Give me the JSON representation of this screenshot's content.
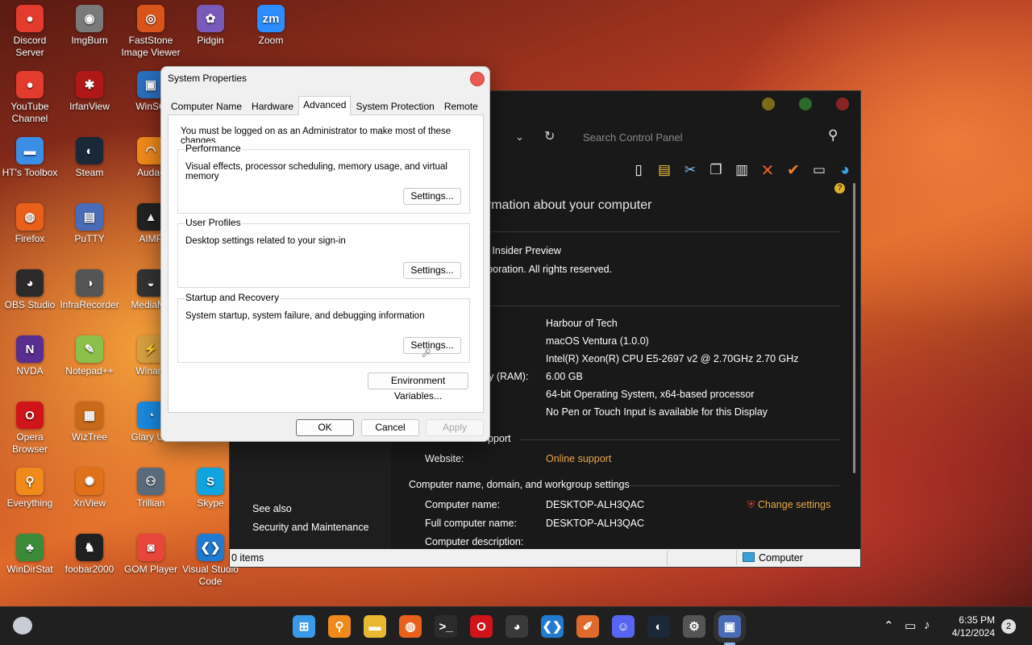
{
  "desktop": {
    "icons": [
      {
        "label": "Discord Server",
        "glyph": "●",
        "color": "#e33b2e"
      },
      {
        "label": "ImgBurn",
        "glyph": "◉",
        "color": "#7a7a7a"
      },
      {
        "label": "FastStone Image Viewer",
        "glyph": "◎",
        "color": "#d8541a"
      },
      {
        "label": "Pidgin",
        "glyph": "✿",
        "color": "#7a5ab8"
      },
      {
        "label": "Zoom",
        "glyph": "zm",
        "color": "#2d8cff"
      },
      {
        "label": "YouTube Channel",
        "glyph": "●",
        "color": "#e33b2e"
      },
      {
        "label": "IrfanView",
        "glyph": "✱",
        "color": "#b01818"
      },
      {
        "label": "WinSC",
        "glyph": "▣",
        "color": "#2a6fbf"
      },
      {
        "label": "HT's Toolbox",
        "glyph": "▬",
        "color": "#3a8ee6"
      },
      {
        "label": "Steam",
        "glyph": "◐",
        "color": "#1b2838"
      },
      {
        "label": "Audac",
        "glyph": "◠",
        "color": "#f08a1a"
      },
      {
        "label": "Firefox",
        "glyph": "◍",
        "color": "#e8601a"
      },
      {
        "label": "PuTTY",
        "glyph": "▤",
        "color": "#4a6cb8"
      },
      {
        "label": "AIMP",
        "glyph": "▲",
        "color": "#222222"
      },
      {
        "label": "OBS Studio",
        "glyph": "◕",
        "color": "#2a2a2a"
      },
      {
        "label": "InfraRecorder",
        "glyph": "◑",
        "color": "#555555"
      },
      {
        "label": "MediaMo",
        "glyph": "◒",
        "color": "#333333"
      },
      {
        "label": "NVDA",
        "glyph": "N",
        "color": "#5a2d91"
      },
      {
        "label": "Notepad++",
        "glyph": "✎",
        "color": "#8cc04a"
      },
      {
        "label": "Winam",
        "glyph": "⚡",
        "color": "#d8a040"
      },
      {
        "label": "Opera Browser",
        "glyph": "O",
        "color": "#d0141a"
      },
      {
        "label": "WizTree",
        "glyph": "▦",
        "color": "#c86a1a"
      },
      {
        "label": "Glary Util",
        "glyph": "◔",
        "color": "#1a8ae0"
      },
      {
        "label": "Everything",
        "glyph": "⚲",
        "color": "#f08a1a"
      },
      {
        "label": "XnView",
        "glyph": "✺",
        "color": "#e0701a"
      },
      {
        "label": "Trillian",
        "glyph": "⚇",
        "color": "#5a6a7a"
      },
      {
        "label": "Skype",
        "glyph": "S",
        "color": "#0ea5e0"
      },
      {
        "label": "WinDirStat",
        "glyph": "♣",
        "color": "#3a8a3a"
      },
      {
        "label": "foobar2000",
        "glyph": "♞",
        "color": "#202020"
      },
      {
        "label": "GOM Player",
        "glyph": "◙",
        "color": "#e8463a"
      },
      {
        "label": "Visual Studio Code",
        "glyph": "❮❯",
        "color": "#1f7ad0"
      }
    ]
  },
  "control_panel": {
    "search_placeholder": "Search Control Panel",
    "heading": "ormation about your computer",
    "windows_edition": {
      "line1": "o Insider Preview",
      "line2": "rporation. All rights reserved."
    },
    "system": {
      "rows": [
        {
          "label": "",
          "value": "Harbour of Tech"
        },
        {
          "label": "",
          "value": "macOS Ventura (1.0.0)"
        },
        {
          "label": "",
          "value": "Intel(R) Xeon(R) CPU E5-2697 v2 @ 2.70GHz   2.70 GHz"
        },
        {
          "label": "ory (RAM):",
          "value": "6.00 GB"
        },
        {
          "label": "",
          "value": "64-bit Operating System, x64-based processor"
        },
        {
          "label": "",
          "value": "No Pen or Touch Input is available for this Display"
        }
      ]
    },
    "support": {
      "section": "pport",
      "website_label": "Website:",
      "website_value": "Online support"
    },
    "computer_name": {
      "section": "Computer name, domain, and workgroup settings",
      "rows": [
        {
          "label": "Computer name:",
          "value": "DESKTOP-ALH3QAC"
        },
        {
          "label": "Full computer name:",
          "value": "DESKTOP-ALH3QAC"
        },
        {
          "label": "Computer description:",
          "value": ""
        }
      ],
      "change_settings": "Change settings"
    },
    "see_also": {
      "title": "See also",
      "item": "Security and Maintenance"
    },
    "status": {
      "items": "0 items",
      "location": "Computer"
    },
    "colors": {
      "link": "#e8a84a",
      "red_light": "#8a2424",
      "yellow_light": "#7a6a1a",
      "green_light": "#2a6a2a"
    }
  },
  "system_properties": {
    "title": "System Properties",
    "tabs": [
      "Computer Name",
      "Hardware",
      "Advanced",
      "System Protection",
      "Remote"
    ],
    "active_tab": "Advanced",
    "admin_note": "You must be logged on as an Administrator to make most of these changes.",
    "groups": [
      {
        "title": "Performance",
        "description": "Visual effects, processor scheduling, memory usage, and virtual memory",
        "button": "Settings..."
      },
      {
        "title": "User Profiles",
        "description": "Desktop settings related to your sign-in",
        "button": "Settings..."
      },
      {
        "title": "Startup and Recovery",
        "description": "System startup, system failure, and debugging information",
        "button": "Settings..."
      }
    ],
    "env_button": "Environment Variables...",
    "ok": "OK",
    "cancel": "Cancel",
    "apply": "Apply"
  },
  "taskbar": {
    "apps": [
      {
        "name": "start",
        "glyph": "⊞",
        "color": "#3a9ae8"
      },
      {
        "name": "search",
        "glyph": "⚲",
        "color": "#f08a1a"
      },
      {
        "name": "file-explorer",
        "glyph": "▬",
        "color": "#e8b830"
      },
      {
        "name": "firefox",
        "glyph": "◍",
        "color": "#e8601a"
      },
      {
        "name": "terminal",
        "glyph": ">_",
        "color": "#2c2c2c"
      },
      {
        "name": "opera",
        "glyph": "O",
        "color": "#d0141a"
      },
      {
        "name": "obs",
        "glyph": "◕",
        "color": "#3a3a3a"
      },
      {
        "name": "vscode",
        "glyph": "❮❯",
        "color": "#1f7ad0"
      },
      {
        "name": "paint",
        "glyph": "✐",
        "color": "#e06a2a"
      },
      {
        "name": "discord",
        "glyph": "☺",
        "color": "#5865f2"
      },
      {
        "name": "steam",
        "glyph": "◐",
        "color": "#1b2838"
      },
      {
        "name": "settings",
        "glyph": "⚙",
        "color": "#555555"
      },
      {
        "name": "system-properties",
        "glyph": "▣",
        "color": "#4a6cb8"
      }
    ],
    "time": "6:35 PM",
    "date": "4/12/2024",
    "notification_count": "2"
  }
}
